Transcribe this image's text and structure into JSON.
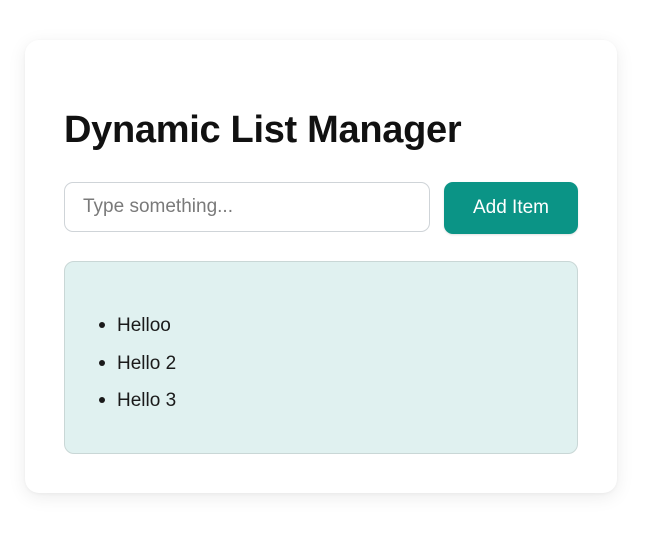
{
  "app": {
    "title": "Dynamic List Manager"
  },
  "input": {
    "placeholder": "Type something...",
    "value": ""
  },
  "add_button": {
    "label": "Add Item"
  },
  "list": {
    "items": [
      {
        "label": "Helloo"
      },
      {
        "label": "Hello 2"
      },
      {
        "label": "Hello 3"
      }
    ]
  },
  "colors": {
    "accent": "#0b9486",
    "list_background": "#e0f1f0",
    "card_background": "#ffffff"
  }
}
